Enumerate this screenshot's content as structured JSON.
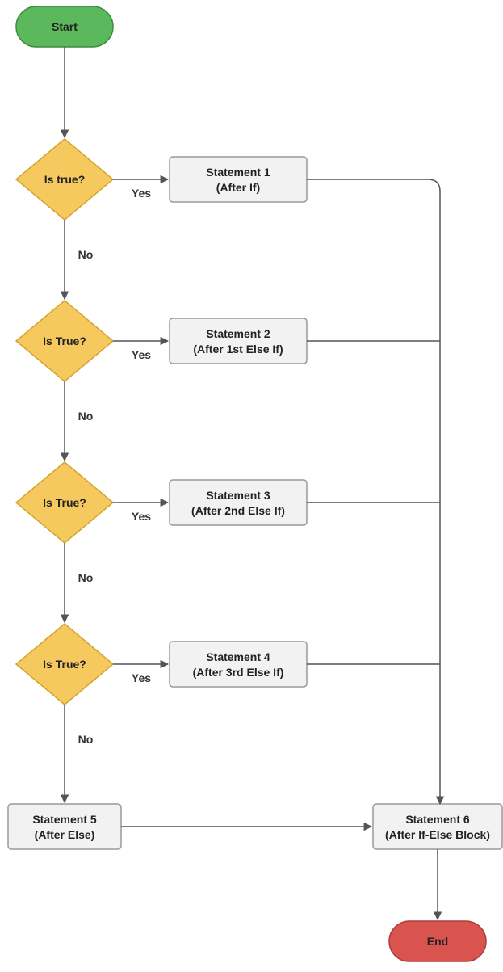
{
  "flowchart": {
    "start": {
      "label": "Start"
    },
    "end": {
      "label": "End"
    },
    "decisions": [
      {
        "label": "Is true?",
        "yes": "Yes",
        "no": "No"
      },
      {
        "label": "Is True?",
        "yes": "Yes",
        "no": "No"
      },
      {
        "label": "Is True?",
        "yes": "Yes",
        "no": "No"
      },
      {
        "label": "Is True?",
        "yes": "Yes",
        "no": "No"
      }
    ],
    "statements": [
      {
        "line1": "Statement 1",
        "line2": "(After If)"
      },
      {
        "line1": "Statement 2",
        "line2": "(After 1st Else If)"
      },
      {
        "line1": "Statement 3",
        "line2": "(After 2nd Else If)"
      },
      {
        "line1": "Statement 4",
        "line2": "(After 3rd Else If)"
      },
      {
        "line1": "Statement 5",
        "line2": "(After Else)"
      },
      {
        "line1": "Statement 6",
        "line2": "(After If-Else Block)"
      }
    ]
  }
}
